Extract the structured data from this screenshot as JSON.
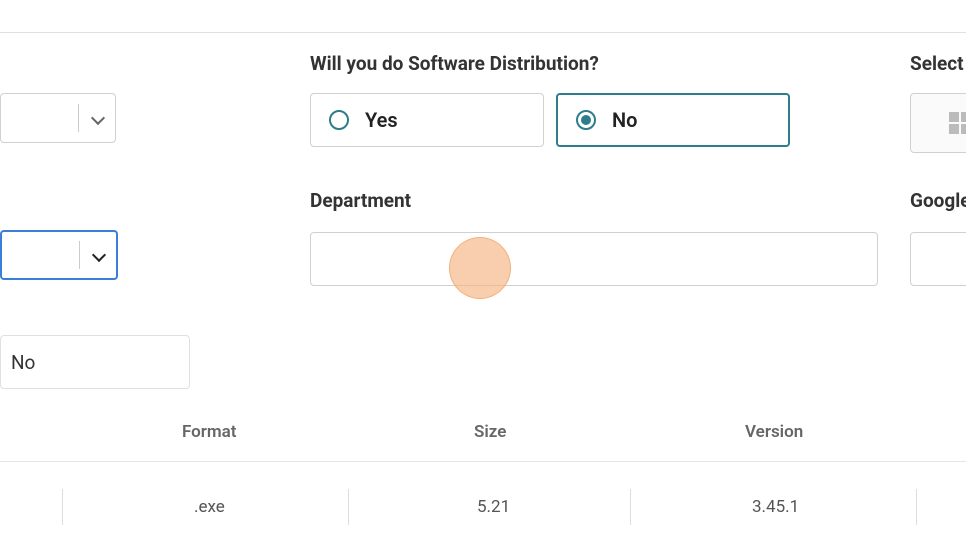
{
  "questions": {
    "software_distribution": {
      "label": "Will you do Software Distribution?",
      "options": {
        "yes": "Yes",
        "no": "No"
      },
      "selected": "no"
    },
    "select_os": {
      "label": "Select"
    },
    "department": {
      "label": "Department",
      "value": ""
    },
    "google": {
      "label": "Google",
      "value": ""
    }
  },
  "readonly": {
    "no_value": "No"
  },
  "table": {
    "headers": {
      "format": "Format",
      "size": "Size",
      "version": "Version"
    },
    "rows": [
      {
        "format": ".exe",
        "size": "5.21",
        "version": "3.45.1"
      }
    ]
  }
}
